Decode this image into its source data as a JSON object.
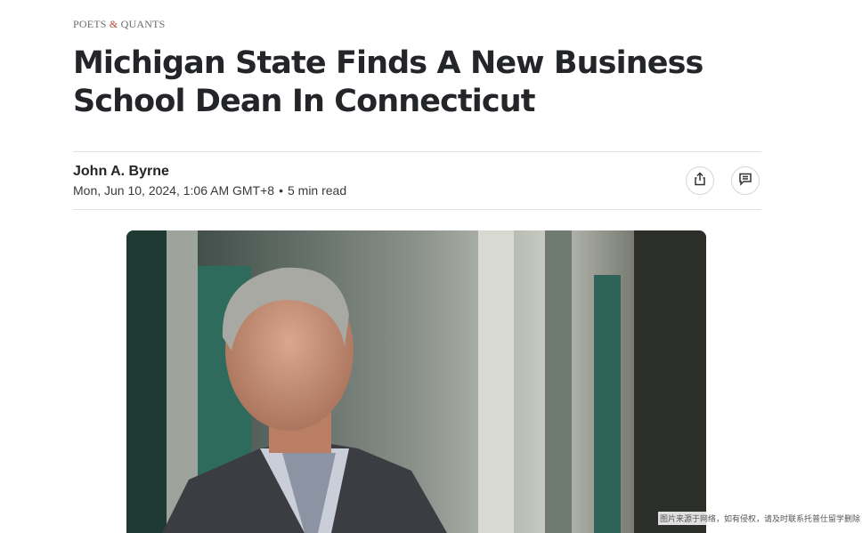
{
  "publisher": {
    "logo_text_1": "POETS ",
    "logo_amp": "&",
    "logo_text_2": " QUANTS"
  },
  "article": {
    "title": "Michigan State Finds A New Business School Dean In Connecticut",
    "author": "John A. Byrne",
    "date": "Mon, Jun 10, 2024, 1:06 AM GMT+8",
    "separator": "•",
    "read_time": "5 min read"
  },
  "actions": {
    "share_icon": "share-icon",
    "comment_icon": "comment-icon"
  },
  "hero_image": {
    "subject": "portrait-photo"
  },
  "watermark": "图片来源于网络，如有侵权，请及时联系托普仕留学删除"
}
